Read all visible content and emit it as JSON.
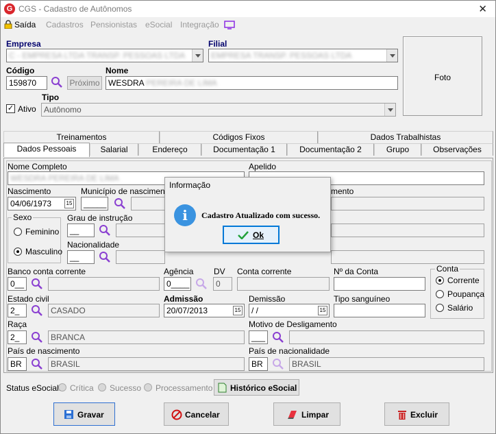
{
  "window": {
    "title": "CGS - Cadastro de Autônomos",
    "logo_letter": "G",
    "close_glyph": "✕"
  },
  "menu": {
    "exit": "Saída",
    "items": [
      "Cadastros",
      "Pensionistas",
      "eSocial",
      "Integração"
    ]
  },
  "header": {
    "empresa_label": "Empresa",
    "empresa_value": "C - EMPRESA LTDA TRANSP. PESSOAS LTDA",
    "filial_label": "Filial",
    "filial_value": "EMPRESA TRANSP. PESSOAS LTDA",
    "codigo_label": "Código",
    "codigo_value": "159870",
    "proximo_label": "Próximo",
    "nome_label": "Nome",
    "nome_value": "WESDRA",
    "nome_blurred": "PEREIRA DE LIMA",
    "ativo_label": "Ativo",
    "ativo_checked": true,
    "tipo_label": "Tipo",
    "tipo_value": "Autônomo",
    "foto_label": "Foto"
  },
  "tabs_row1": [
    "Treinamentos",
    "Códigos Fixos",
    "Dados Trabalhistas"
  ],
  "tabs_row2": [
    "Dados Pessoais",
    "Salarial",
    "Endereço",
    "Documentação 1",
    "Documentação 2",
    "Grupo",
    "Observações"
  ],
  "active_tab": "Dados Pessoais",
  "form": {
    "nome_completo_label": "Nome Completo",
    "nome_completo_value": "WESDRA PEREIRA DE LIMA",
    "apelido_label": "Apelido",
    "nascimento_label": "Nascimento",
    "nascimento_value": "04/06/1973",
    "municipio_label": "Município de nascimento",
    "municipio_code": "_____",
    "naturalidade_label_tail": "mento",
    "sexo_label": "Sexo",
    "sexo_options": [
      "Feminino",
      "Masculino"
    ],
    "sexo_selected": "Masculino",
    "grau_label": "Grau de instrução",
    "grau_code": "__",
    "nacionalidade_label": "Nacionalidade",
    "nacionalidade_code": "__",
    "banco_label": "Banco conta corrente",
    "banco_code": "0__",
    "agencia_label": "Agência",
    "agencia_value": "0____",
    "dv_label": "DV",
    "dv_value": "0",
    "conta_corrente_label": "Conta corrente",
    "numero_conta_label": "Nº da Conta",
    "conta_label": "Conta",
    "conta_options": [
      "Corrente",
      "Poupança",
      "Salário"
    ],
    "conta_selected": "Corrente",
    "estado_civil_label": "Estado civil",
    "estado_civil_code": "2_",
    "estado_civil_value": "CASADO",
    "admissao_label": "Admissão",
    "admissao_value": "20/07/2013",
    "demissao_label": "Demissão",
    "demissao_value": " / /",
    "tipo_sanguineo_label": "Tipo sanguíneo",
    "raca_label": "Raça",
    "raca_code": "2_",
    "raca_value": "BRANCA",
    "motivo_label": "Motivo de Desligamento",
    "motivo_code": "___",
    "pais_nasc_label": "País de nascimento",
    "pais_nasc_code": "BR",
    "pais_nasc_value": "BRASIL",
    "pais_nac_label": "País de nacionalidade",
    "pais_nac_code": "BR",
    "pais_nac_value": "BRASIL",
    "date_btn": "15"
  },
  "status": {
    "label": "Status eSocial:",
    "options": [
      "Crítica",
      "Sucesso",
      "Processamento"
    ],
    "historico": "Histórico eSocial"
  },
  "actions": {
    "gravar": "Gravar",
    "cancelar": "Cancelar",
    "limpar": "Limpar",
    "excluir": "Excluir"
  },
  "dialog": {
    "title": "Informação",
    "icon": "i",
    "message": "Cadastro Atualizado com sucesso.",
    "ok": "Ok"
  },
  "colors": {
    "accent": "#0078d7",
    "search": "#8a3fd1",
    "label_blue": "#00006c",
    "info": "#3a93e0"
  }
}
